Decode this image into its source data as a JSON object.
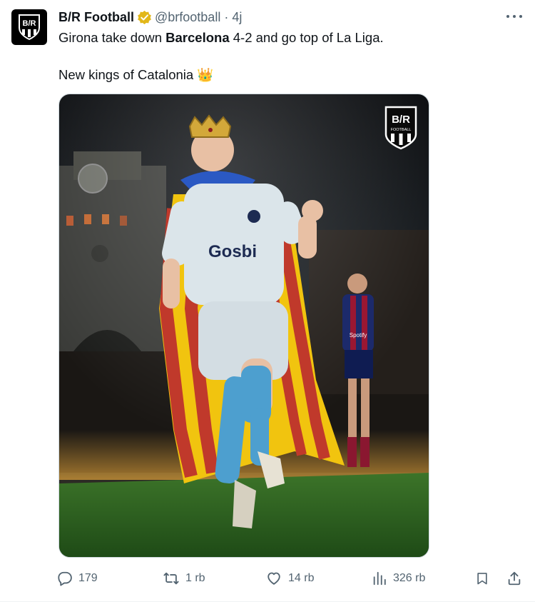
{
  "post": {
    "author_name": "B/R Football",
    "handle": "@brfootball",
    "separator": "·",
    "time": "4j",
    "text_line1_pre": "Girona take down ",
    "text_line1_bold": "Barcelona",
    "text_line1_post": " 4-2 and go top of La Liga.",
    "text_line2": "New kings of Catalonia",
    "text_line2_emoji": "👑"
  },
  "avatar": {
    "logo_text": "B/R"
  },
  "media": {
    "logo_text": "B/R",
    "logo_subtext": "FOOTBALL",
    "jersey_sponsor": "Gosbi",
    "opponent_sponsor": "Spotify"
  },
  "actions": {
    "replies": "179",
    "reposts": "1 rb",
    "likes": "14 rb",
    "views": "326 rb"
  },
  "colors": {
    "text_primary": "#0f1419",
    "text_secondary": "#536471",
    "verified_gold": "#e2b719",
    "catalan_yellow": "#f1c40f",
    "catalan_red": "#c0392b",
    "pitch_green": "#3f7a2a"
  },
  "icons": [
    "verified-badge-icon",
    "more-icon",
    "reply-icon",
    "repost-icon",
    "like-icon",
    "views-icon",
    "bookmark-icon",
    "share-icon"
  ]
}
